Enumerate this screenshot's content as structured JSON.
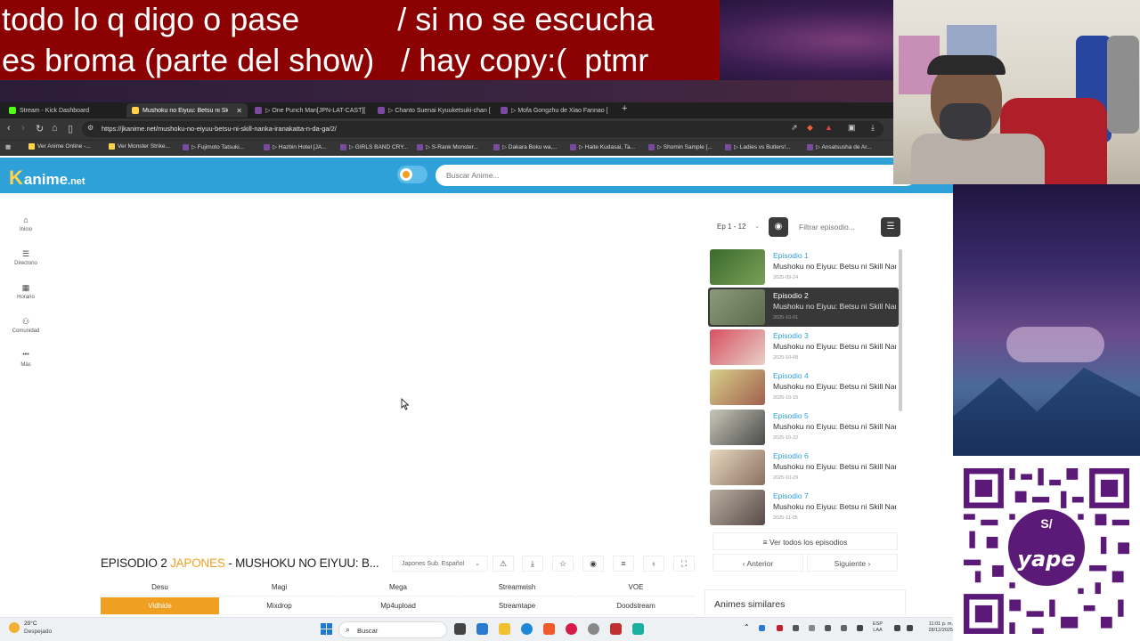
{
  "overlay": {
    "line1": "todo lo q digo o pase           / si no se escucha",
    "line2": "es broma (parte del show)   / hay copy:(  ptmr"
  },
  "browser": {
    "tabs": [
      {
        "label": "Stream - Kick Dashboard",
        "color": "#53fc18"
      },
      {
        "label": "Mushoku no Eiyuu: Betsu ni Skill",
        "color": "#ffd24a"
      },
      {
        "label": "▷ One Punch Man[JPN-LAT-CAST][",
        "color": "#7a4aa0"
      },
      {
        "label": "▷ Chanto Suenai Kyuuketsuki-chan [",
        "color": "#7a4aa0"
      },
      {
        "label": "▷ Mofa Gongzhu de Xiao Fannao [",
        "color": "#7a4aa0"
      }
    ],
    "new_tab": "+",
    "url": "https://jkanime.net/mushoku-no-eiyuu-betsu-ni-skill-nanka-iranakatta-n-da-ga/2/",
    "bookmarks": [
      "Ver Anime Online -...",
      "Ver Monster Strike...",
      "▷ Fujimoto Tatsuki...",
      "▷ Hazbin Hotel [JA...",
      "▷ GIRLS BAND CRY...",
      "▷ S-Rank Monster...",
      "▷ Dakara Boku wa,...",
      "▷ Haite Kudasai, Ta...",
      "▷ Shomin Sample [...",
      "▷ Ladies vs Butlers!...",
      "▷ Ansatsusha de Ar..."
    ]
  },
  "site": {
    "logo_k": "K",
    "logo_name": "anime",
    "logo_tld": ".net",
    "search_placeholder": "Buscar Anime...",
    "accent": "#2ea1d9",
    "highlight": "#f0a020"
  },
  "sidenav": [
    {
      "icon": "home-icon",
      "glyph": "⌂",
      "label": "Inicio"
    },
    {
      "icon": "list-icon",
      "glyph": "☰",
      "label": "Directorio"
    },
    {
      "icon": "calendar-icon",
      "glyph": "▦",
      "label": "Horario"
    },
    {
      "icon": "community-icon",
      "glyph": "⚇",
      "label": "Comunidad"
    },
    {
      "icon": "more-icon",
      "glyph": "•••",
      "label": "Más"
    }
  ],
  "episode_panel": {
    "range": "Ep 1 - 12",
    "filter_placeholder": "Filtrar episodio...",
    "episodes": [
      {
        "title": "Episodio 1",
        "name": "Mushoku no Eiyuu: Betsu ni Skill Nanka Iranakatta n da ga",
        "date": "2025-09-24",
        "thumb": "#4a7a3a"
      },
      {
        "title": "Episodio 2",
        "name": "Mushoku no Eiyuu: Betsu ni Skill Nanka Iranakatta n da ga",
        "date": "2025-10-01",
        "thumb": "#6a7a5a"
      },
      {
        "title": "Episodio 3",
        "name": "Mushoku no Eiyuu: Betsu ni Skill Nanka Iranakatta n da ga",
        "date": "2025-10-08",
        "thumb": "#c0485a"
      },
      {
        "title": "Episodio 4",
        "name": "Mushoku no Eiyuu: Betsu ni Skill Nanka Iranakatta n da ga",
        "date": "2025-10-15",
        "thumb": "#a8a060"
      },
      {
        "title": "Episodio 5",
        "name": "Mushoku no Eiyuu: Betsu ni Skill Nanka Iranakatta n da ga",
        "date": "2025-10-22",
        "thumb": "#6a6a5a"
      },
      {
        "title": "Episodio 6",
        "name": "Mushoku no Eiyuu: Betsu ni Skill Nanka Iranakatta n da ga",
        "date": "2025-10-29",
        "thumb": "#8a7060"
      },
      {
        "title": "Episodio 7",
        "name": "Mushoku no Eiyuu: Betsu ni Skill Nanka Iranakatta n da ga",
        "date": "2025-11-05",
        "thumb": "#7a6a5a"
      }
    ],
    "all_episodes": "≡ Ver todos los episodios",
    "prev": "‹  Anterior",
    "next": "Siguiente  ›",
    "similar_title": "Animes similares"
  },
  "player": {
    "ep_prefix": "EPISODIO 2 ",
    "ep_lang": "JAPONES",
    "ep_rest": " - MUSHOKU NO EIYUU: B...",
    "audio": "Japones Sub. Español",
    "tools": [
      {
        "icon": "warning-icon",
        "glyph": "⚠"
      },
      {
        "icon": "download-icon",
        "glyph": "⤓"
      },
      {
        "icon": "star-icon",
        "glyph": "☆"
      },
      {
        "icon": "eye-icon",
        "glyph": "◉"
      },
      {
        "icon": "playlist-icon",
        "glyph": "≡"
      },
      {
        "icon": "light-icon",
        "glyph": "♁"
      },
      {
        "icon": "expand-icon",
        "glyph": "⛶"
      }
    ],
    "servers_row1": [
      "Desu",
      "Magi",
      "Mega",
      "Streamwish",
      "VOE"
    ],
    "servers_row2": [
      "Vidhide",
      "Mixdrop",
      "Mp4upload",
      "Streamtape",
      "Doodstream"
    ]
  },
  "yape": {
    "s": "S/",
    "name": "yape",
    "color": "#5c1a78"
  },
  "taskbar": {
    "temp": "20°C",
    "weather": "Despejado",
    "search": "Buscar",
    "lang1": "ESP",
    "lang2": "LAA",
    "time": "11:01 p. m.",
    "date": "28/12/2025"
  }
}
